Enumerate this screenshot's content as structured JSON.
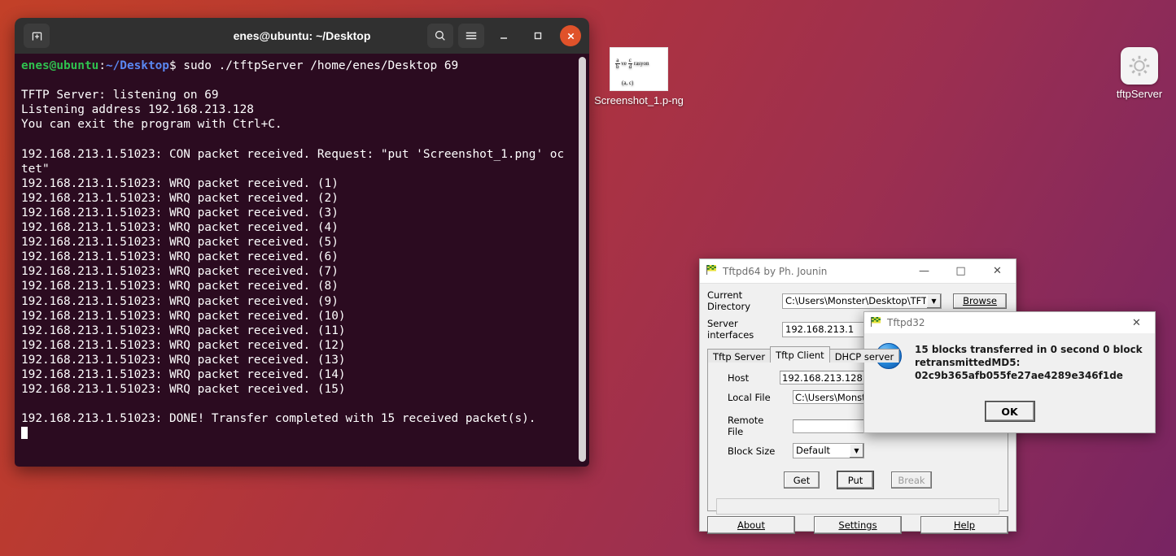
{
  "desktop": {
    "background_from": "#c24028",
    "background_to": "#772462",
    "icons": [
      {
        "name": "screenshot-file",
        "label": "Screenshot_1.p-ng",
        "thumb_line1_a_num": "a",
        "thumb_line1_a_den": "b",
        "thumb_mid": "ve",
        "thumb_line1_c_num": "c",
        "thumb_line1_c_den": "d",
        "thumb_tail": "rasyon",
        "thumb_line2": "(a, c)"
      },
      {
        "name": "tftpserver-binary",
        "label": "tftpServer",
        "icon": "gear-icon"
      }
    ]
  },
  "terminal": {
    "title": "enes@ubuntu: ~/Desktop",
    "new_tab_icon": "new-tab-icon",
    "search_icon": "search-icon",
    "menu_icon": "hamburger-menu-icon",
    "minimize_icon": "minimize-icon",
    "maximize_icon": "maximize-icon",
    "close_icon": "close-icon",
    "prompt": {
      "user_host": "enes@ubuntu",
      "colon": ":",
      "path": "~/Desktop",
      "dollar": "$",
      "command": " sudo ./tftpServer /home/enes/Desktop 69"
    },
    "output_lines": [
      "",
      "TFTP Server: listening on 69",
      "Listening address 192.168.213.128",
      "You can exit the program with Ctrl+C.",
      "",
      "192.168.213.1.51023: CON packet received. Request: \"put 'Screenshot_1.png' oc",
      "tet\"",
      "192.168.213.1.51023: WRQ packet received. (1)",
      "192.168.213.1.51023: WRQ packet received. (2)",
      "192.168.213.1.51023: WRQ packet received. (3)",
      "192.168.213.1.51023: WRQ packet received. (4)",
      "192.168.213.1.51023: WRQ packet received. (5)",
      "192.168.213.1.51023: WRQ packet received. (6)",
      "192.168.213.1.51023: WRQ packet received. (7)",
      "192.168.213.1.51023: WRQ packet received. (8)",
      "192.168.213.1.51023: WRQ packet received. (9)",
      "192.168.213.1.51023: WRQ packet received. (10)",
      "192.168.213.1.51023: WRQ packet received. (11)",
      "192.168.213.1.51023: WRQ packet received. (12)",
      "192.168.213.1.51023: WRQ packet received. (13)",
      "192.168.213.1.51023: WRQ packet received. (14)",
      "192.168.213.1.51023: WRQ packet received. (15)",
      "",
      "192.168.213.1.51023: DONE! Transfer completed with 15 received packet(s)."
    ]
  },
  "tftpd64": {
    "title": "Tftpd64 by Ph. Jounin",
    "app_icon": "checkered-flag-icon",
    "minimize_label": "—",
    "maximize_label": "□",
    "close_label": "✕",
    "fields": {
      "current_directory_label": "Current Directory",
      "current_directory_value": "C:\\Users\\Monster\\Desktop\\TFTP",
      "browse_label": "Browse",
      "server_interfaces_label": "Server interfaces",
      "server_interfaces_value": "192.168.213.1",
      "host_label": "Host",
      "host_value": "192.168.213.128",
      "local_file_label": "Local File",
      "local_file_value": "C:\\Users\\Monster\\D",
      "remote_file_label": "Remote File",
      "remote_file_value": "",
      "block_size_label": "Block Size",
      "block_size_value": "Default"
    },
    "tabs": [
      {
        "label": "Tftp Server",
        "active": false
      },
      {
        "label": "Tftp Client",
        "active": true
      },
      {
        "label": "DHCP server",
        "active": false
      }
    ],
    "actions": [
      {
        "label": "Get",
        "enabled": true
      },
      {
        "label": "Put",
        "enabled": true
      },
      {
        "label": "Break",
        "enabled": false
      }
    ],
    "progress_text": "",
    "footer": [
      {
        "label": "About"
      },
      {
        "label": "Settings"
      },
      {
        "label": "Help"
      }
    ]
  },
  "tftpd32_dialog": {
    "title": "Tftpd32",
    "app_icon": "checkered-flag-icon",
    "close_label": "✕",
    "info_icon": "info-icon",
    "info_glyph": "i",
    "message": "15 blocks transferred in 0 second 0 block retransmittedMD5: 02c9b365afb055fe27ae4289e346f1de",
    "message_lines": [
      "15 blocks transferred in 0 second 0 block",
      "retransmittedMD5:",
      "02c9b365afb055fe27ae4289e346f1de"
    ],
    "ok_label": "OK"
  }
}
